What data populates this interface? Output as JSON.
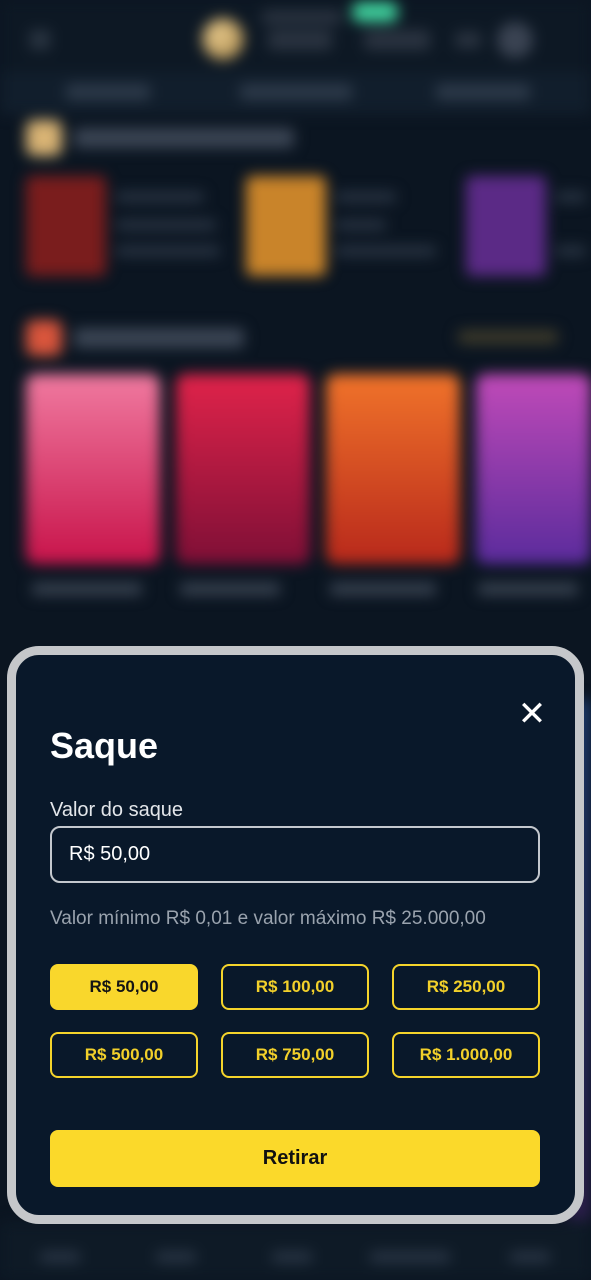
{
  "withdraw_modal": {
    "title": "Saque",
    "amount_label": "Valor do saque",
    "amount_value": "R$ 50,00",
    "limits_hint": "Valor mínimo R$ 0,01 e valor máximo R$ 25.000,00",
    "close_icon": "close-icon",
    "quick_amounts": [
      {
        "label": "R$ 50,00",
        "selected": true
      },
      {
        "label": "R$ 100,00",
        "selected": false
      },
      {
        "label": "R$ 250,00",
        "selected": false
      },
      {
        "label": "R$ 500,00",
        "selected": false
      },
      {
        "label": "R$ 750,00",
        "selected": false
      },
      {
        "label": "R$ 1.000,00",
        "selected": false
      }
    ],
    "submit_label": "Retirar"
  },
  "colors": {
    "accent": "#fbd92a",
    "modal_bg": "#09182a",
    "page_bg": "#0b1521"
  }
}
